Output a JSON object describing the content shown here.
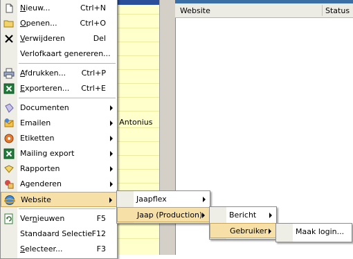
{
  "background": {
    "list_headers": {
      "website": "Website",
      "status": "Status"
    },
    "cell_text": "a Antonius"
  },
  "main_menu": {
    "items": [
      {
        "label": "Nieuw...",
        "ul": "N",
        "rest": "ieuw...",
        "shortcut": "Ctrl+N",
        "icon": "new-icon"
      },
      {
        "label": "Openen...",
        "ul": "O",
        "rest": "penen...",
        "shortcut": "Ctrl+O",
        "icon": "open-icon"
      },
      {
        "label": "Verwijderen",
        "ul": "V",
        "rest": "erwijderen",
        "shortcut": "Del",
        "icon": "delete-x-icon"
      },
      {
        "label": "Verlofkaart genereren...",
        "shortcut": ""
      },
      {
        "label": "Afdrukken...",
        "ul": "A",
        "rest": "fdrukken...",
        "shortcut": "Ctrl+P",
        "icon": "printer-icon"
      },
      {
        "label": "Exporteren...",
        "ul": "E",
        "rest": "xporteren...",
        "shortcut": "Ctrl+E",
        "icon": "excel-icon"
      },
      {
        "label": "Documenten",
        "icon": "documents-icon"
      },
      {
        "label": "Emailen",
        "icon": "email-icon"
      },
      {
        "label": "Etiketten",
        "icon": "labels-icon"
      },
      {
        "label": "Mailing export",
        "icon": "excel-icon"
      },
      {
        "label": "Rapporten",
        "icon": "reports-icon"
      },
      {
        "label": "Agenderen",
        "icon": "calendar-icon"
      },
      {
        "label": "Website",
        "icon": "globe-icon"
      },
      {
        "label": "Vernieuwen",
        "ul": "n",
        "pre": "Ver",
        "rest": "ieuwen",
        "shortcut": "F5",
        "icon": "refresh-icon"
      },
      {
        "label": "Standaard Selectie",
        "shortcut": "F12"
      },
      {
        "label": "Selecteer...",
        "ul": "S",
        "rest": "electeer...",
        "shortcut": "F3"
      }
    ]
  },
  "website_submenu": {
    "items": [
      "Jaapflex",
      "Jaap (Production)"
    ]
  },
  "production_submenu": {
    "items": [
      "Bericht",
      "Gebruiker"
    ]
  },
  "gebruiker_submenu": {
    "items": [
      "Maak login..."
    ]
  },
  "colors": {
    "highlight": "#f7e0a8",
    "highlight_border": "#c9a557",
    "menu_strip": "#eeeee6"
  }
}
